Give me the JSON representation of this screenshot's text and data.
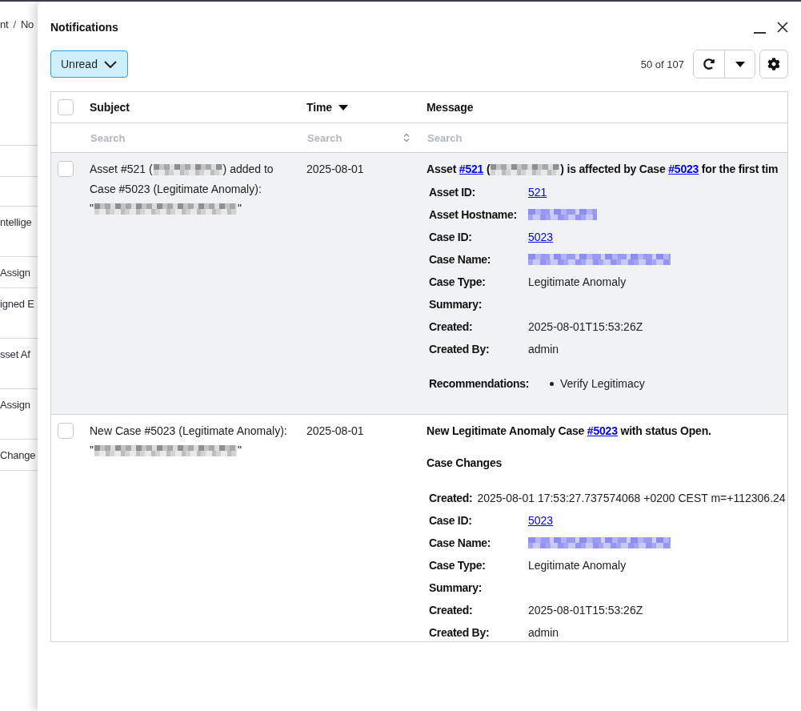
{
  "background_page": {
    "breadcrumb": {
      "items": [
        "nt",
        "No"
      ],
      "separator": "/"
    },
    "list_items": [
      "ntellige",
      "Assign",
      "igned E",
      "sset Af",
      "Assign",
      "Change"
    ]
  },
  "notifications_panel": {
    "title": "Notifications",
    "filter_button": {
      "label": "Unread"
    },
    "count": "50 of 107",
    "table": {
      "select_all": {
        "checked": false
      },
      "columns": [
        {
          "label": "Subject",
          "filter": {
            "kind": "text",
            "placeholder": "Search"
          }
        },
        {
          "label": "Time",
          "sorted": true,
          "filter": {
            "kind": "select",
            "placeholder": "Search"
          }
        },
        {
          "label": "Message",
          "filter": {
            "kind": "text",
            "placeholder": "Search"
          }
        }
      ],
      "rows": [
        {
          "checked": false,
          "highlighted": true,
          "subject": [
            {
              "kind": "text",
              "text": "Asset #521 ("
            },
            {
              "kind": "redacted_short"
            },
            {
              "kind": "text",
              "text": ") added to Case #5023 (Legitimate Anomaly): \""
            },
            {
              "kind": "redacted_long"
            },
            {
              "kind": "text",
              "text": "\""
            }
          ],
          "time": "2025-08-01",
          "message": [
            {
              "kind": "headline",
              "parts": [
                {
                  "kind": "text",
                  "text": "Asset "
                },
                {
                  "kind": "link",
                  "text": "#521"
                },
                {
                  "kind": "text",
                  "text": " ("
                },
                {
                  "kind": "redacted_short"
                },
                {
                  "kind": "text",
                  "text": ") is affected by Case "
                },
                {
                  "kind": "link",
                  "text": "#5023"
                },
                {
                  "kind": "text",
                  "text": " for the first tim"
                }
              ]
            },
            {
              "kind": "fields",
              "fields": [
                {
                  "label": "Asset ID:",
                  "value": {
                    "kind": "link",
                    "text": "521"
                  }
                },
                {
                  "label": "Asset Hostname:",
                  "value": {
                    "kind": "redacted_short",
                    "link": true
                  }
                },
                {
                  "label": "Case ID:",
                  "value": {
                    "kind": "link",
                    "text": "5023"
                  }
                },
                {
                  "label": "Case Name:",
                  "value": {
                    "kind": "redacted_long",
                    "link": true
                  }
                },
                {
                  "label": "Case Type:",
                  "value": {
                    "kind": "text",
                    "text": "Legitimate Anomaly"
                  }
                },
                {
                  "label": "Summary:"
                },
                {
                  "label": "Created:",
                  "value": {
                    "kind": "text",
                    "text": "2025-08-01T15:53:26Z"
                  }
                },
                {
                  "label": "Created By:",
                  "value": {
                    "kind": "text",
                    "text": "admin"
                  }
                }
              ]
            },
            {
              "kind": "list",
              "label": "Recommendations:",
              "items": [
                "Verify Legitimacy"
              ]
            }
          ]
        },
        {
          "checked": false,
          "highlighted": false,
          "subject": [
            {
              "kind": "text",
              "text": "New Case #5023 (Legitimate Anomaly): \""
            },
            {
              "kind": "redacted_long"
            },
            {
              "kind": "text",
              "text": "\""
            }
          ],
          "time": "2025-08-01",
          "message": [
            {
              "kind": "headline",
              "parts": [
                {
                  "kind": "text",
                  "text": "New Legitimate Anomaly Case "
                },
                {
                  "kind": "link",
                  "text": "#5023"
                },
                {
                  "kind": "text",
                  "text": " with status Open."
                }
              ]
            },
            {
              "kind": "heading",
              "text": "Case Changes"
            },
            {
              "kind": "inline_field",
              "label": "Created:",
              "value": "2025-08-01 17:53:27.737574068 +0200 CEST m=+112306.24"
            },
            {
              "kind": "fields",
              "fields": [
                {
                  "label": "Case ID:",
                  "value": {
                    "kind": "link",
                    "text": "5023"
                  }
                },
                {
                  "label": "Case Name:",
                  "value": {
                    "kind": "redacted_long",
                    "link": true
                  }
                },
                {
                  "label": "Case Type:",
                  "value": {
                    "kind": "text",
                    "text": "Legitimate Anomaly"
                  }
                },
                {
                  "label": "Summary:"
                },
                {
                  "label": "Created:",
                  "value": {
                    "kind": "text",
                    "text": "2025-08-01T15:53:26Z"
                  }
                },
                {
                  "label": "Created By:",
                  "value": {
                    "kind": "text",
                    "text": "admin"
                  }
                }
              ]
            }
          ]
        }
      ]
    }
  }
}
